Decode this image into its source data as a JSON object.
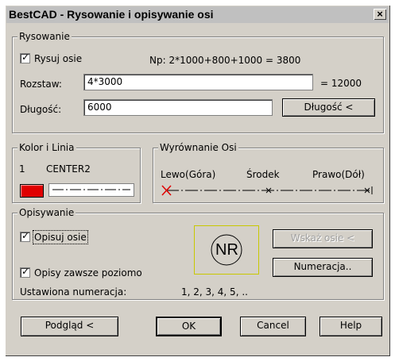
{
  "window": {
    "title": "BestCAD - Rysowanie i opisywanie osi",
    "close_glyph": "×"
  },
  "rysowanie": {
    "legend": "Rysowanie",
    "draw_checkbox_label": "Rysuj osie",
    "draw_checked": true,
    "example": "Np: 2*1000+800+1000 = 3800",
    "spacing_label": "Rozstaw:",
    "spacing_value": "4*3000",
    "spacing_result": "= 12000",
    "length_label": "Długość:",
    "length_value": "6000",
    "length_button": "Długość <"
  },
  "kolor": {
    "legend": "Kolor i Linia",
    "color_index": "1",
    "linetype": "CENTER2",
    "color_hex": "#e00000"
  },
  "wyrownanie": {
    "legend": "Wyrównanie Osi",
    "left": "Lewo(Góra)",
    "middle": "Środek",
    "right": "Prawo(Dół)"
  },
  "opisywanie": {
    "legend": "Opisywanie",
    "label_checkbox": "Opisuj osie",
    "label_checked": true,
    "horizontal_checkbox": "Opisy zawsze poziomo",
    "horizontal_checked": true,
    "numbering_label": "Ustawiona numeracja:",
    "numbering_value": "1, 2, 3, 4, 5, ..",
    "preview_symbol": "NR",
    "point_axes_button": "Wskaż osie <",
    "numbering_button": "Numeracja.."
  },
  "buttons": {
    "preview": "Podgląd <",
    "ok": "OK",
    "cancel": "Cancel",
    "help": "Help"
  }
}
